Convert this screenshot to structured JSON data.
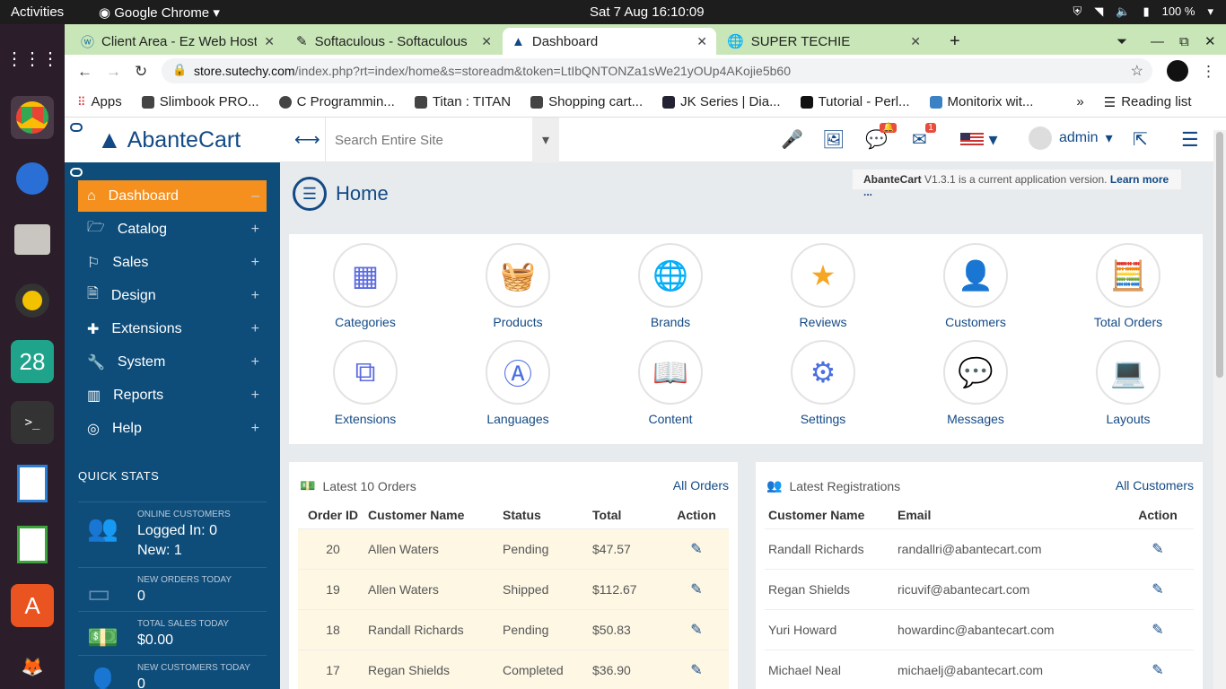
{
  "os": {
    "activities": "Activities",
    "app_name": "Google Chrome",
    "clock": "Sat 7 Aug  16:10:09",
    "battery": "100 %"
  },
  "dock": {
    "calendar_day": "28"
  },
  "browser": {
    "tabs": [
      {
        "label": "Client Area - Ez Web Hosti"
      },
      {
        "label": "Softaculous - Softaculous"
      },
      {
        "label": "Dashboard"
      },
      {
        "label": "SUPER TECHIE"
      }
    ],
    "url_host": "store.sutechy.com",
    "url_rest": "/index.php?rt=index/home&s=storeadm&token=LtIbQNTONZa1sWe21yOUp4AKojie5b60",
    "bookmarks": [
      {
        "label": "Apps"
      },
      {
        "label": "Slimbook PRO..."
      },
      {
        "label": "C Programmin..."
      },
      {
        "label": "Titan : TITAN"
      },
      {
        "label": "Shopping cart..."
      },
      {
        "label": "JK Series | Dia..."
      },
      {
        "label": "Tutorial - Perl..."
      },
      {
        "label": "Monitorix wit..."
      }
    ],
    "more": "»",
    "reading_list": "Reading list"
  },
  "app": {
    "logo_text": "AbanteCart",
    "search_placeholder": "Search Entire Site",
    "notifications_badge": "",
    "messages_badge": "1",
    "user": "admin",
    "version_prefix": "AbanteCart",
    "version_text": " V1.3.1 is a current application version. ",
    "version_link": "Learn more ...",
    "page_title": "Home"
  },
  "sidebar": {
    "items": [
      {
        "label": "Dashboard",
        "sign": "–"
      },
      {
        "label": "Catalog",
        "sign": "+"
      },
      {
        "label": "Sales",
        "sign": "+"
      },
      {
        "label": "Design",
        "sign": "+"
      },
      {
        "label": "Extensions",
        "sign": "+"
      },
      {
        "label": "System",
        "sign": "+"
      },
      {
        "label": "Reports",
        "sign": "+"
      },
      {
        "label": "Help",
        "sign": "+"
      }
    ],
    "quick_stats_title": "QUICK STATS",
    "stats": [
      {
        "label": "ONLINE CUSTOMERS",
        "value": "Logged In: 0",
        "value2": "New: 1"
      },
      {
        "label": "NEW ORDERS TODAY",
        "value": "0"
      },
      {
        "label": "TOTAL SALES TODAY",
        "value": "$0.00"
      },
      {
        "label": "NEW CUSTOMERS TODAY",
        "value": "0"
      }
    ]
  },
  "shortcuts": [
    {
      "label": "Categories"
    },
    {
      "label": "Products"
    },
    {
      "label": "Brands"
    },
    {
      "label": "Reviews"
    },
    {
      "label": "Customers"
    },
    {
      "label": "Total Orders"
    },
    {
      "label": "Extensions"
    },
    {
      "label": "Languages"
    },
    {
      "label": "Content"
    },
    {
      "label": "Settings"
    },
    {
      "label": "Messages"
    },
    {
      "label": "Layouts"
    }
  ],
  "orders_panel": {
    "title": "Latest 10 Orders",
    "link": "All Orders",
    "headers": [
      "Order ID",
      "Customer Name",
      "Status",
      "Total",
      "Action"
    ],
    "rows": [
      {
        "id": "20",
        "name": "Allen Waters",
        "status": "Pending",
        "total": "$47.57"
      },
      {
        "id": "19",
        "name": "Allen Waters",
        "status": "Shipped",
        "total": "$112.67"
      },
      {
        "id": "18",
        "name": "Randall Richards",
        "status": "Pending",
        "total": "$50.83"
      },
      {
        "id": "17",
        "name": "Regan Shields",
        "status": "Completed",
        "total": "$36.90"
      }
    ]
  },
  "registrations_panel": {
    "title": "Latest Registrations",
    "link": "All Customers",
    "headers": [
      "Customer Name",
      "Email",
      "Action"
    ],
    "rows": [
      {
        "name": "Randall Richards",
        "email": "randallri@abantecart.com"
      },
      {
        "name": "Regan Shields",
        "email": "ricuvif@abantecart.com"
      },
      {
        "name": "Yuri Howard",
        "email": "howardinc@abantecart.com"
      },
      {
        "name": "Michael Neal",
        "email": "michaelj@abantecart.com"
      }
    ]
  },
  "colors": {
    "sidebar_bg": "#0e4d7a",
    "accent_orange": "#f5901e",
    "brand_blue": "#134a86",
    "tabbar_green": "#c8e6b8"
  }
}
